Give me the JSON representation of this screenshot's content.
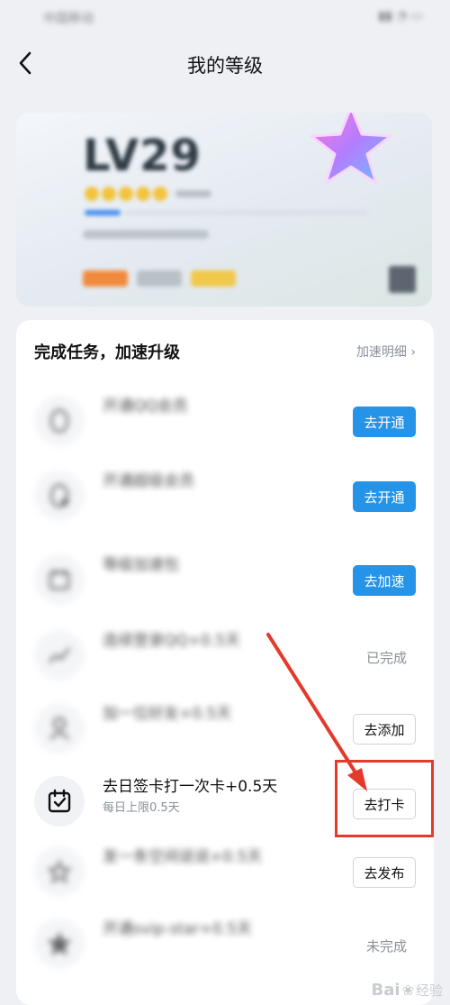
{
  "status_bar": {
    "carrier": "中国移动",
    "right": ""
  },
  "header": {
    "title": "我的等级"
  },
  "level_card": {
    "level": "LV29"
  },
  "tasks_panel": {
    "title": "完成任务，加速升级",
    "detail_link": "加速明细",
    "items": [
      {
        "title": "开通QQ会员",
        "subtitle": "",
        "icon": "penguin-icon",
        "action": "去开通",
        "action_type": "button-primary",
        "blurred": true
      },
      {
        "title": "开通超级会员",
        "subtitle": "",
        "icon": "penguin-icon",
        "action": "去开通",
        "action_type": "button-primary",
        "blurred": true
      },
      {
        "title": "等级加速包",
        "subtitle": "",
        "icon": "calendar-icon",
        "action": "去加速",
        "action_type": "button-primary",
        "blurred": true
      },
      {
        "title": "连续登录QQ+0.5天",
        "subtitle": "",
        "icon": "chart-icon",
        "action": "已完成",
        "action_type": "text",
        "blurred": true
      },
      {
        "title": "加一位好友+0.5天",
        "subtitle": "",
        "icon": "person-icon",
        "action": "去添加",
        "action_type": "button-outline",
        "blurred": true
      },
      {
        "title": "去日签卡打一次卡+0.5天",
        "subtitle": "每日上限0.5天",
        "icon": "calendar-check-icon",
        "action": "去打卡",
        "action_type": "button-outline",
        "blurred": false
      },
      {
        "title": "发一条空间说说+0.5天",
        "subtitle": "",
        "icon": "star-icon",
        "action": "去发布",
        "action_type": "button-outline",
        "blurred": true
      },
      {
        "title": "开通svip-star+0.5天",
        "subtitle": "",
        "icon": "star-icon",
        "action": "未完成",
        "action_type": "text",
        "blurred": true
      }
    ]
  },
  "annotation": {
    "color": "#e43a2c"
  },
  "watermark": {
    "text": "Bai",
    "sub": "经验"
  },
  "colors": {
    "accent": "#2493e8",
    "annotation": "#e43a2c",
    "panel_bg": "#ffffff",
    "page_bg": "#eef0f4"
  }
}
